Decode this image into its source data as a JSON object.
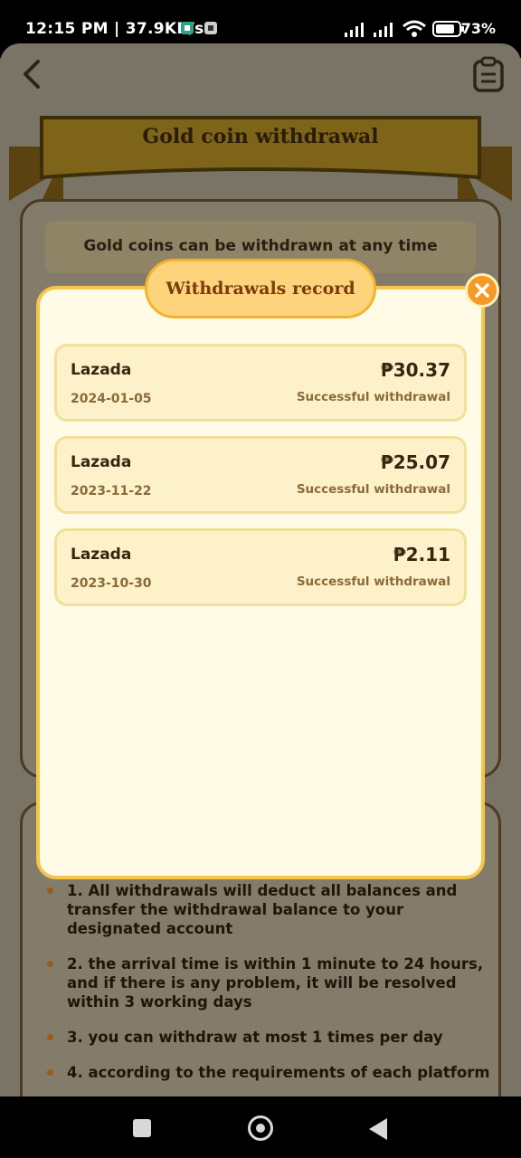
{
  "status_bar": {
    "time": "12:15 PM | 37.9KB/s",
    "battery": "73%"
  },
  "page": {
    "title": "Gold coin withdrawal",
    "notice": "Gold coins can be withdrawn at any time"
  },
  "rules": [
    "1. All withdrawals will deduct all balances and transfer the withdrawal balance to your designated account",
    "2. the arrival time is within 1 minute to 24 hours, and if there is any problem, it will be resolved within 3 working days",
    "3. you can withdraw at most 1 times per day",
    "4. according to the requirements of each platform"
  ],
  "modal": {
    "title": "Withdrawals record",
    "records": [
      {
        "merchant": "Lazada",
        "date": "2024-01-05",
        "amount": "₱30.37",
        "status": "Successful withdrawal"
      },
      {
        "merchant": "Lazada",
        "date": "2023-11-22",
        "amount": "₱25.07",
        "status": "Successful withdrawal"
      },
      {
        "merchant": "Lazada",
        "date": "2023-10-30",
        "amount": "₱2.11",
        "status": "Successful withdrawal"
      }
    ]
  },
  "colors": {
    "modal_bg": "#fffbe6",
    "modal_border": "#f6c64b",
    "close_button": "#f59a22",
    "title_text": "#7a3c0c"
  }
}
